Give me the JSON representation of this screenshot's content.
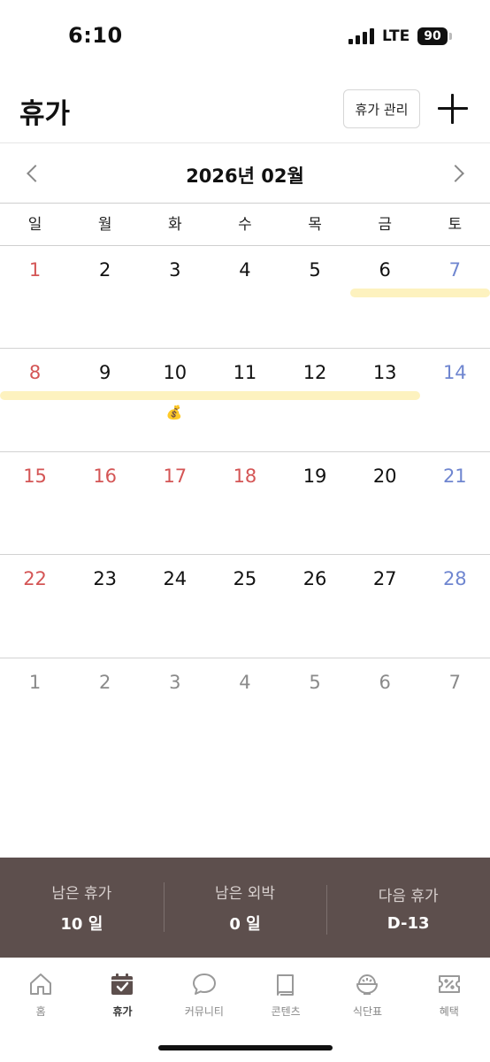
{
  "status_bar": {
    "time": "6:10",
    "network": "LTE",
    "battery": "90"
  },
  "header": {
    "title": "휴가",
    "manage_label": "휴가 관리"
  },
  "calendar": {
    "month_title": "2026년 02월",
    "weekdays": [
      "일",
      "월",
      "화",
      "수",
      "목",
      "금",
      "토"
    ],
    "weeks": [
      [
        "1",
        "2",
        "3",
        "4",
        "5",
        "6",
        "7"
      ],
      [
        "8",
        "9",
        "10",
        "11",
        "12",
        "13",
        "14"
      ],
      [
        "15",
        "16",
        "17",
        "18",
        "19",
        "20",
        "21"
      ],
      [
        "22",
        "23",
        "24",
        "25",
        "26",
        "27",
        "28"
      ],
      [
        "1",
        "2",
        "3",
        "4",
        "5",
        "6",
        "7"
      ]
    ],
    "money_bag": "💰"
  },
  "summary": {
    "items": [
      {
        "label": "남은 휴가",
        "value": "10 일"
      },
      {
        "label": "남은 외박",
        "value": "0 일"
      },
      {
        "label": "다음 휴가",
        "value": "D-13"
      }
    ]
  },
  "tabs": [
    {
      "label": "홈",
      "icon": "home-icon"
    },
    {
      "label": "휴가",
      "icon": "calendar-check-icon"
    },
    {
      "label": "커뮤니티",
      "icon": "chat-bubble-icon"
    },
    {
      "label": "콘텐츠",
      "icon": "book-icon"
    },
    {
      "label": "식단표",
      "icon": "rice-bowl-icon"
    },
    {
      "label": "혜택",
      "icon": "coupon-icon"
    }
  ],
  "colors": {
    "sunday": "#d45555",
    "saturday": "#6f86d0",
    "vacation": "#fdf2bf",
    "panel": "#5d4f4d"
  }
}
